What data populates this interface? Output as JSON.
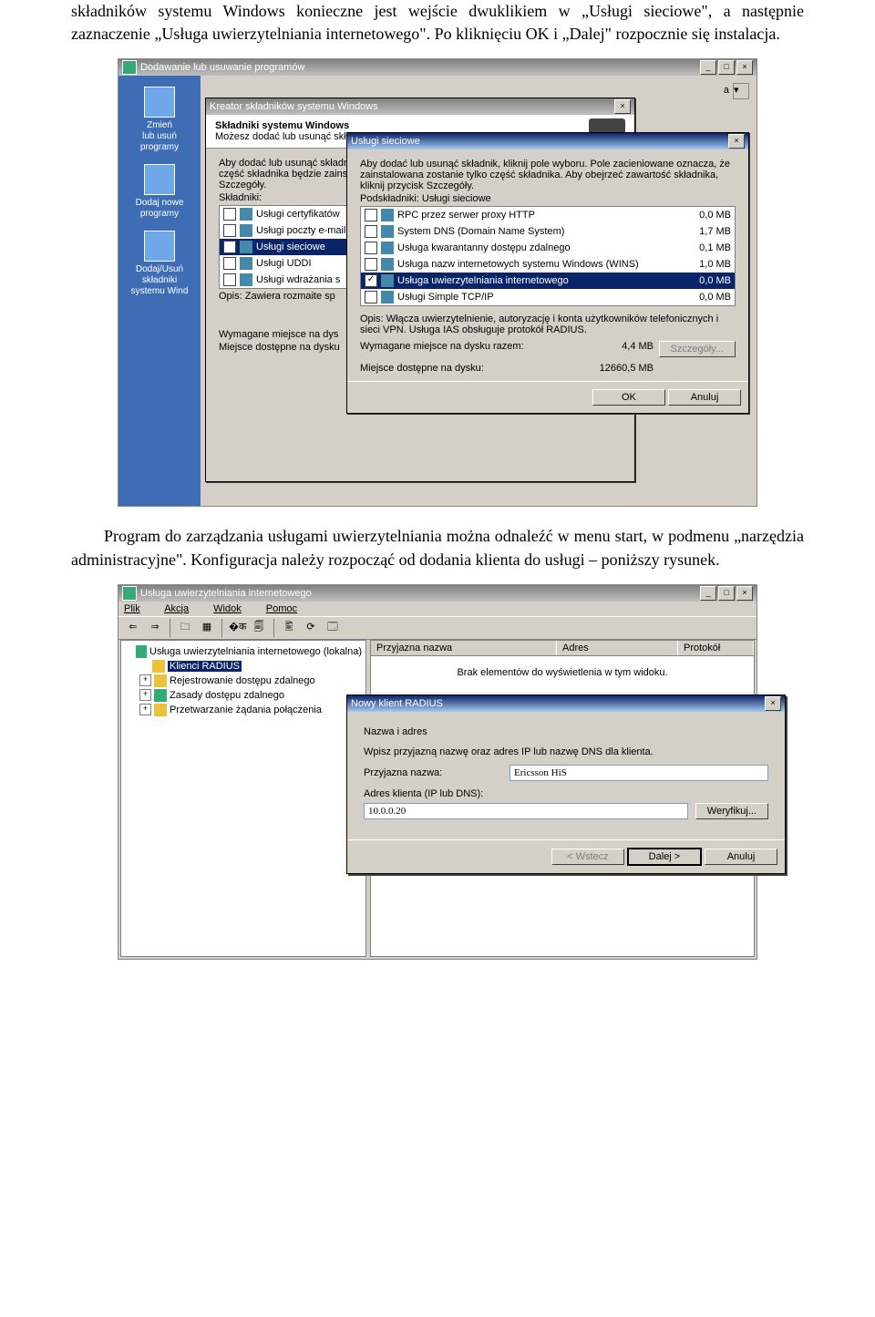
{
  "para1": "składników systemu Windows konieczne jest wejście dwuklikiem w „Usługi sieciowe\", a następnie zaznaczenie „Usługa uwierzytelniania internetowego\". Po kliknięciu OK i „Dalej\" rozpocznie się instalacja.",
  "para2": "Program do zarządzania usługami uwierzytelniania można odnaleźć w menu start, w podmenu „narzędzia administracyjne\". Konfiguracja należy rozpocząć od dodania klienta do usługi – poniższy rysunek.",
  "shot1": {
    "bg_title": "Dodawanie lub usuwanie programów",
    "side": [
      {
        "l1": "Zmień",
        "l2": "lub usuń",
        "l3": "programy"
      },
      {
        "l1": "Dodaj nowe",
        "l2": "programy",
        "l3": ""
      },
      {
        "l1": "Dodaj/Usuń",
        "l2": "składniki",
        "l3": "systemu Wind"
      }
    ],
    "dd_label": "a",
    "wizard": {
      "title": "Kreator składników systemu Windows",
      "h1": "Składniki systemu Windows",
      "h2": "Możesz dodać lub usunąć składniki systemu Windows.",
      "intro": "Aby dodać lub usunąć składnik, kliknij pole wyboru. Pole zacieniowane oznacza, że tylko część składnika będzie zainstalowana. Aby obejrzeć zawartość składnika, kliknij przycisk Szczegóły.",
      "listlabel": "Składniki:",
      "items": [
        {
          "name": "Usługi certyfikatów",
          "chk": ""
        },
        {
          "name": "Usługi poczty e-mail",
          "chk": ""
        },
        {
          "name": "Usługi sieciowe",
          "chk": "",
          "sel": true
        },
        {
          "name": "Usługi UDDI",
          "chk": ""
        },
        {
          "name": "Usługi wdrażania s",
          "chk": ""
        }
      ],
      "desc_l": "Opis:",
      "desc": "Zawiera rozmaite sp",
      "req_l": "Wymagane miejsce na dys",
      "avail_l": "Miejsce dostępne na dysku"
    },
    "sub": {
      "title": "Usługi sieciowe",
      "intro": "Aby dodać lub usunąć składnik, kliknij pole wyboru. Pole zacieniowane oznacza, że zainstalowana zostanie tylko część składnika. Aby obejrzeć zawartość składnika, kliknij przycisk Szczegóły.",
      "listlabel": "Podskładniki: Usługi sieciowe",
      "items": [
        {
          "name": "RPC przez serwer proxy HTTP",
          "size": "0,0 MB",
          "chk": ""
        },
        {
          "name": "System DNS (Domain Name System)",
          "size": "1,7 MB",
          "chk": ""
        },
        {
          "name": "Usługa kwarantanny dostępu zdalnego",
          "size": "0,1 MB",
          "chk": ""
        },
        {
          "name": "Usługa nazw internetowych systemu Windows (WINS)",
          "size": "1,0 MB",
          "chk": ""
        },
        {
          "name": "Usługa uwierzytelniania internetowego",
          "size": "0,0 MB",
          "chk": "✓",
          "sel": true
        },
        {
          "name": "Usługi Simple TCP/IP",
          "size": "0,0 MB",
          "chk": ""
        }
      ],
      "desc_l": "Opis:",
      "desc": "Włącza uwierzytelnienie, autoryzację i konta użytkowników telefonicznych i sieci VPN. Usługa IAS obsługuje protokół RADIUS.",
      "req_l": "Wymagane miejsce na dysku razem:",
      "req_v": "4,4 MB",
      "avail_l": "Miejsce dostępne na dysku:",
      "avail_v": "12660,5 MB",
      "details": "Szczegóły...",
      "ok": "OK",
      "cancel": "Anuluj"
    }
  },
  "shot2": {
    "title": "Usługa uwierzytelniania internetowego",
    "menu": [
      "Plik",
      "Akcja",
      "Widok",
      "Pomoc"
    ],
    "tool": [
      "⇐",
      "⇒",
      "|",
      "🗀",
      "▦",
      "|",
      "�क",
      "🗐",
      "|",
      "🖺",
      "⟳",
      "🗔"
    ],
    "tree": [
      {
        "t": "Usługa uwierzytelniania internetowego (lokalna)",
        "exp": "",
        "ind": 0,
        "ic": "g"
      },
      {
        "t": "Klienci RADIUS",
        "exp": "",
        "ind": 1,
        "ic": "y",
        "sel": true
      },
      {
        "t": "Rejestrowanie dostępu zdalnego",
        "exp": "+",
        "ind": 1,
        "ic": "y"
      },
      {
        "t": "Zasady dostępu zdalnego",
        "exp": "+",
        "ind": 1,
        "ic": "g"
      },
      {
        "t": "Przetwarzanie żądania połączenia",
        "exp": "+",
        "ind": 1,
        "ic": "y"
      }
    ],
    "cols": [
      "Przyjazna nazwa",
      "Adres",
      "Protokół"
    ],
    "empty": "Brak elementów do wyświetlenia w tym widoku.",
    "dlg": {
      "title": "Nowy klient RADIUS",
      "h": "Nazwa i adres",
      "intro": "Wpisz przyjazną nazwę oraz adres IP lub nazwę DNS dla klienta.",
      "fn_l": "Przyjazna nazwa:",
      "fn_v": "Ericsson HiS",
      "addr_l": "Adres klienta (IP lub DNS):",
      "addr_v": "10.0.0.20",
      "verify": "Weryfikuj...",
      "back": "< Wstecz",
      "next": "Dalej >",
      "cancel": "Anuluj"
    }
  }
}
